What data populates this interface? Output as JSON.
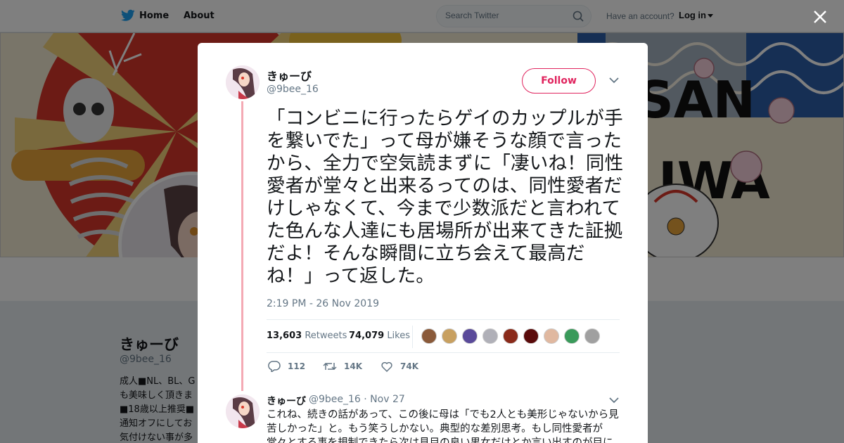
{
  "nav": {
    "home_label": "Home",
    "about_label": "About",
    "search_placeholder": "Search Twitter",
    "have_account": "Have an account?",
    "login_label": "Log in"
  },
  "background_profile": {
    "name": "きゅーび",
    "handle": "@9bee_16",
    "bio": "成人■NL、BL、G\nも美味しく頂きま\n■18歳以上推奨■\n通知オフにしてお\n気付けない事が多"
  },
  "banner": {
    "text_san": "SAN",
    "text_iwa": "IWA"
  },
  "tweet": {
    "author_name": "きゅーび",
    "author_handle": "@9bee_16",
    "follow_label": "Follow",
    "text": "「コンビニに行ったらゲイのカップルが手を繋いでた」って母が嫌そうな顔で言ったから、全力で空気読まずに「凄いね！同性愛者が堂々と出来るってのは、同性愛者だけしゃなくて、今まで少数派だと言われてた色んな人達にも居場所が出来てきた証拠だよ！そんな瞬間に立ち会えて最高だね！」って返した。",
    "timestamp": "2:19 PM - 26 Nov 2019",
    "retweets_count": "13,603",
    "retweets_label": "Retweets",
    "likes_count": "74,079",
    "likes_label": "Likes",
    "replies_short": "112",
    "retweets_short": "14K",
    "likes_short": "74K"
  },
  "reply": {
    "author_name": "きゅーび",
    "meta": "@9bee_16 · Nov 27",
    "text": "これね、続きの話があって、この後に母は「でも2人とも美形じゃないから見苦しかった」と。もう笑うしかない。典型的な差別思考。もし同性愛者が堂々とする事を規制できたら次は見目の良い男女だけとか言い出すのが目に見えて"
  },
  "liker_colors": [
    "#8a5a3a",
    "#c8a060",
    "#5a4a9a",
    "#b0b0b8",
    "#8a2a1a",
    "#5a0a0a",
    "#e0b8a0",
    "#3a9a5a",
    "#a0a0a0"
  ],
  "colors": {
    "accent": "#e0245e",
    "thread_line": "#f4aab4",
    "secondary_text": "#657786",
    "primary_text": "#14171a",
    "twitter_blue": "#1da1f2"
  }
}
